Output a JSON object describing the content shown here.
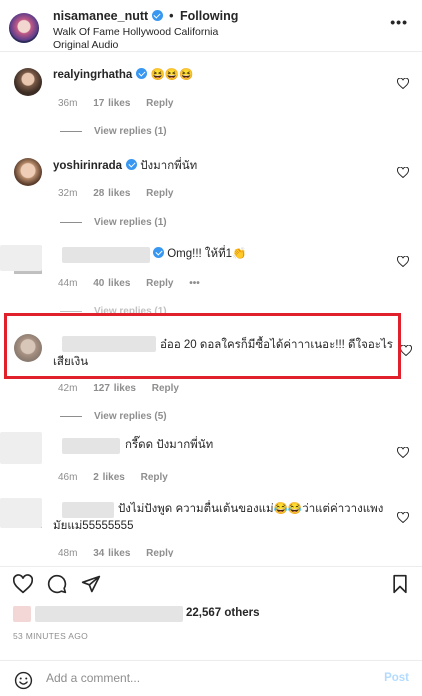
{
  "header": {
    "username": "nisamanee_nutt",
    "separator": "•",
    "follow_status": "Following",
    "location": "Walk Of Fame Hollywood California",
    "audio": "Original Audio"
  },
  "comments": [
    {
      "username": "realyingrhatha",
      "text": "😆😆😆",
      "age": "36m",
      "likes": "17 likes",
      "reply": "Reply",
      "view_replies": "View replies (1)"
    },
    {
      "username": "yoshirinrada",
      "text": "ปังมากพี่นัท",
      "age": "32m",
      "likes": "28 likes",
      "reply": "Reply",
      "view_replies": "View replies (1)"
    },
    {
      "username": "",
      "text": "Omg!!! ให้ที่1👏",
      "age": "44m",
      "likes": "40 likes",
      "reply": "Reply",
      "more": "•••",
      "view_replies": "View replies (1)"
    },
    {
      "username": "",
      "text_line1": "อ๋ออ 20 ดอลใครก็มีซื้อได้ค่าาาเนอะ!!! ดีใจอะไร",
      "text_line2": "เสียเงิน",
      "age": "42m",
      "likes": "127 likes",
      "reply": "Reply",
      "view_replies": "View replies (5)"
    },
    {
      "username": "",
      "text": "กรี๊ดด ปังมากพี่นัท",
      "age": "46m",
      "likes": "2 likes",
      "reply": "Reply"
    },
    {
      "username": "",
      "text_line1": "ปังไม่ปังพูด ความตื่นเต้นของแม่😂😂ว่าแต่ค่าวางแพง",
      "text_line2": "มัยแม่55555555",
      "age": "48m",
      "likes": "34 likes",
      "reply": "Reply"
    }
  ],
  "likes_summary": "22,567 others",
  "timestamp": "53 MINUTES AGO",
  "add_comment": {
    "placeholder": "Add a comment...",
    "post_label": "Post"
  },
  "colors": {
    "verified": "#3897f0",
    "highlight": "#e0202a",
    "post_disabled": "#b3dbff",
    "muted": "#8e8e8e"
  }
}
